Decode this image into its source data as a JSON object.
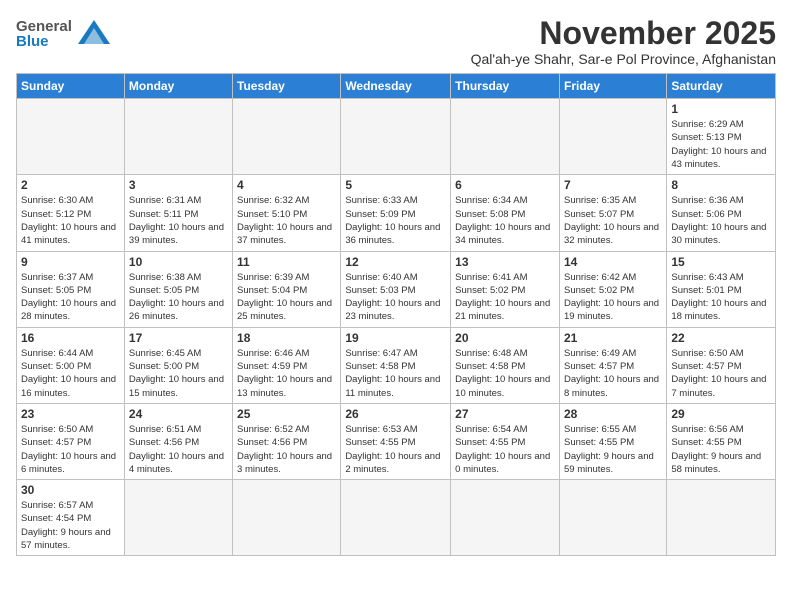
{
  "logo": {
    "text_general": "General",
    "text_blue": "Blue"
  },
  "header": {
    "month": "November 2025",
    "location": "Qal'ah-ye Shahr, Sar-e Pol Province, Afghanistan"
  },
  "weekdays": [
    "Sunday",
    "Monday",
    "Tuesday",
    "Wednesday",
    "Thursday",
    "Friday",
    "Saturday"
  ],
  "weeks": [
    [
      {
        "day": "",
        "info": ""
      },
      {
        "day": "",
        "info": ""
      },
      {
        "day": "",
        "info": ""
      },
      {
        "day": "",
        "info": ""
      },
      {
        "day": "",
        "info": ""
      },
      {
        "day": "",
        "info": ""
      },
      {
        "day": "1",
        "info": "Sunrise: 6:29 AM\nSunset: 5:13 PM\nDaylight: 10 hours and 43 minutes."
      }
    ],
    [
      {
        "day": "2",
        "info": "Sunrise: 6:30 AM\nSunset: 5:12 PM\nDaylight: 10 hours and 41 minutes."
      },
      {
        "day": "3",
        "info": "Sunrise: 6:31 AM\nSunset: 5:11 PM\nDaylight: 10 hours and 39 minutes."
      },
      {
        "day": "4",
        "info": "Sunrise: 6:32 AM\nSunset: 5:10 PM\nDaylight: 10 hours and 37 minutes."
      },
      {
        "day": "5",
        "info": "Sunrise: 6:33 AM\nSunset: 5:09 PM\nDaylight: 10 hours and 36 minutes."
      },
      {
        "day": "6",
        "info": "Sunrise: 6:34 AM\nSunset: 5:08 PM\nDaylight: 10 hours and 34 minutes."
      },
      {
        "day": "7",
        "info": "Sunrise: 6:35 AM\nSunset: 5:07 PM\nDaylight: 10 hours and 32 minutes."
      },
      {
        "day": "8",
        "info": "Sunrise: 6:36 AM\nSunset: 5:06 PM\nDaylight: 10 hours and 30 minutes."
      }
    ],
    [
      {
        "day": "9",
        "info": "Sunrise: 6:37 AM\nSunset: 5:05 PM\nDaylight: 10 hours and 28 minutes."
      },
      {
        "day": "10",
        "info": "Sunrise: 6:38 AM\nSunset: 5:05 PM\nDaylight: 10 hours and 26 minutes."
      },
      {
        "day": "11",
        "info": "Sunrise: 6:39 AM\nSunset: 5:04 PM\nDaylight: 10 hours and 25 minutes."
      },
      {
        "day": "12",
        "info": "Sunrise: 6:40 AM\nSunset: 5:03 PM\nDaylight: 10 hours and 23 minutes."
      },
      {
        "day": "13",
        "info": "Sunrise: 6:41 AM\nSunset: 5:02 PM\nDaylight: 10 hours and 21 minutes."
      },
      {
        "day": "14",
        "info": "Sunrise: 6:42 AM\nSunset: 5:02 PM\nDaylight: 10 hours and 19 minutes."
      },
      {
        "day": "15",
        "info": "Sunrise: 6:43 AM\nSunset: 5:01 PM\nDaylight: 10 hours and 18 minutes."
      }
    ],
    [
      {
        "day": "16",
        "info": "Sunrise: 6:44 AM\nSunset: 5:00 PM\nDaylight: 10 hours and 16 minutes."
      },
      {
        "day": "17",
        "info": "Sunrise: 6:45 AM\nSunset: 5:00 PM\nDaylight: 10 hours and 15 minutes."
      },
      {
        "day": "18",
        "info": "Sunrise: 6:46 AM\nSunset: 4:59 PM\nDaylight: 10 hours and 13 minutes."
      },
      {
        "day": "19",
        "info": "Sunrise: 6:47 AM\nSunset: 4:58 PM\nDaylight: 10 hours and 11 minutes."
      },
      {
        "day": "20",
        "info": "Sunrise: 6:48 AM\nSunset: 4:58 PM\nDaylight: 10 hours and 10 minutes."
      },
      {
        "day": "21",
        "info": "Sunrise: 6:49 AM\nSunset: 4:57 PM\nDaylight: 10 hours and 8 minutes."
      },
      {
        "day": "22",
        "info": "Sunrise: 6:50 AM\nSunset: 4:57 PM\nDaylight: 10 hours and 7 minutes."
      }
    ],
    [
      {
        "day": "23",
        "info": "Sunrise: 6:50 AM\nSunset: 4:57 PM\nDaylight: 10 hours and 6 minutes."
      },
      {
        "day": "24",
        "info": "Sunrise: 6:51 AM\nSunset: 4:56 PM\nDaylight: 10 hours and 4 minutes."
      },
      {
        "day": "25",
        "info": "Sunrise: 6:52 AM\nSunset: 4:56 PM\nDaylight: 10 hours and 3 minutes."
      },
      {
        "day": "26",
        "info": "Sunrise: 6:53 AM\nSunset: 4:55 PM\nDaylight: 10 hours and 2 minutes."
      },
      {
        "day": "27",
        "info": "Sunrise: 6:54 AM\nSunset: 4:55 PM\nDaylight: 10 hours and 0 minutes."
      },
      {
        "day": "28",
        "info": "Sunrise: 6:55 AM\nSunset: 4:55 PM\nDaylight: 9 hours and 59 minutes."
      },
      {
        "day": "29",
        "info": "Sunrise: 6:56 AM\nSunset: 4:55 PM\nDaylight: 9 hours and 58 minutes."
      }
    ],
    [
      {
        "day": "30",
        "info": "Sunrise: 6:57 AM\nSunset: 4:54 PM\nDaylight: 9 hours and 57 minutes."
      },
      {
        "day": "",
        "info": ""
      },
      {
        "day": "",
        "info": ""
      },
      {
        "day": "",
        "info": ""
      },
      {
        "day": "",
        "info": ""
      },
      {
        "day": "",
        "info": ""
      },
      {
        "day": "",
        "info": ""
      }
    ]
  ]
}
